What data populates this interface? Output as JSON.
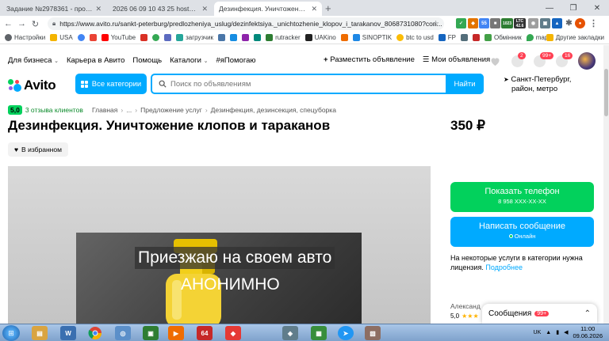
{
  "browser": {
    "tabs": [
      {
        "title": "Задание №2978361 - просмотр з",
        "favicon": "SP",
        "color": "#d93025"
      },
      {
        "title": "2026 06 09 10 43 25 hosted at Im",
        "favicon": "img",
        "color": "#1a73e8"
      },
      {
        "title": "Дезинфекция. Уничтожение клоп",
        "favicon": "avito",
        "color": "#00aaff"
      }
    ],
    "url": "https://www.avito.ru/sankt-peterburg/predlozheniya_uslug/dezinfektsiya._unichtozhenie_klopov_i_tarakanov_8068731080?con...",
    "bookmarks": [
      "Настройки",
      "USA",
      "",
      "",
      "YouTube",
      "",
      "",
      "",
      "загрузчик",
      "",
      "",
      "",
      "",
      "rutracker",
      "UAKino",
      "",
      "SINOPTIK",
      "btc to usd",
      "FP",
      "",
      "",
      "Обмінник",
      "maps"
    ],
    "bookmarks_other": "Другие закладки",
    "ext_labels": {
      "ltc": "LTC",
      "ltc_val": "42.6",
      "btc_val": "1023",
      "badge": "55"
    }
  },
  "site": {
    "topnav": [
      {
        "label": "Для бизнеса",
        "caret": true
      },
      {
        "label": "Карьера в Авито",
        "caret": false
      },
      {
        "label": "Помощь",
        "caret": false
      },
      {
        "label": "Каталоги",
        "caret": true
      },
      {
        "label": "#яПомогаю",
        "caret": false
      }
    ],
    "post_ad": "Разместить объявление",
    "my_ads": "Мои объявления",
    "counters": {
      "notifications": "2",
      "messages": "99+",
      "cart": "16"
    },
    "logo": "Avito",
    "categories_button": "Все категории",
    "search_placeholder": "Поиск по объявлениям",
    "search_button": "Найти",
    "location_line1": "Санкт-Петербург,",
    "location_line2": "район, метро"
  },
  "listing": {
    "rating_score": "5,0",
    "rating_reviews": "3 отзыва клиентов",
    "breadcrumbs": [
      "Главная",
      "...",
      "Предложение услуг",
      "Дезинфекция, дезинсекция, спецуборка"
    ],
    "title": "Дезинфекция. Уничтожение клопов и тараканов",
    "price": "350 ₽",
    "favorite_label": "В избранном",
    "photo_caption_1": "Приезжаю на своем авто",
    "photo_caption_2": "АНОНИМНО",
    "phone_button": "Показать телефон",
    "phone_masked": "8 958 XXX-XX-XX",
    "message_button": "Написать сообщение",
    "online_status": "Онлайн",
    "license_text": "На некоторые услуги в категории нужна лицензия.",
    "license_link": "Подробнее",
    "seller_name": "Александ",
    "seller_rating": "5,0",
    "seller_stars": "★★★",
    "messages_label": "Сообщения",
    "messages_count": "99+"
  },
  "taskbar": {
    "lang": "UK",
    "time": "11:00",
    "date": "09.06.2026",
    "app_64": "64"
  }
}
